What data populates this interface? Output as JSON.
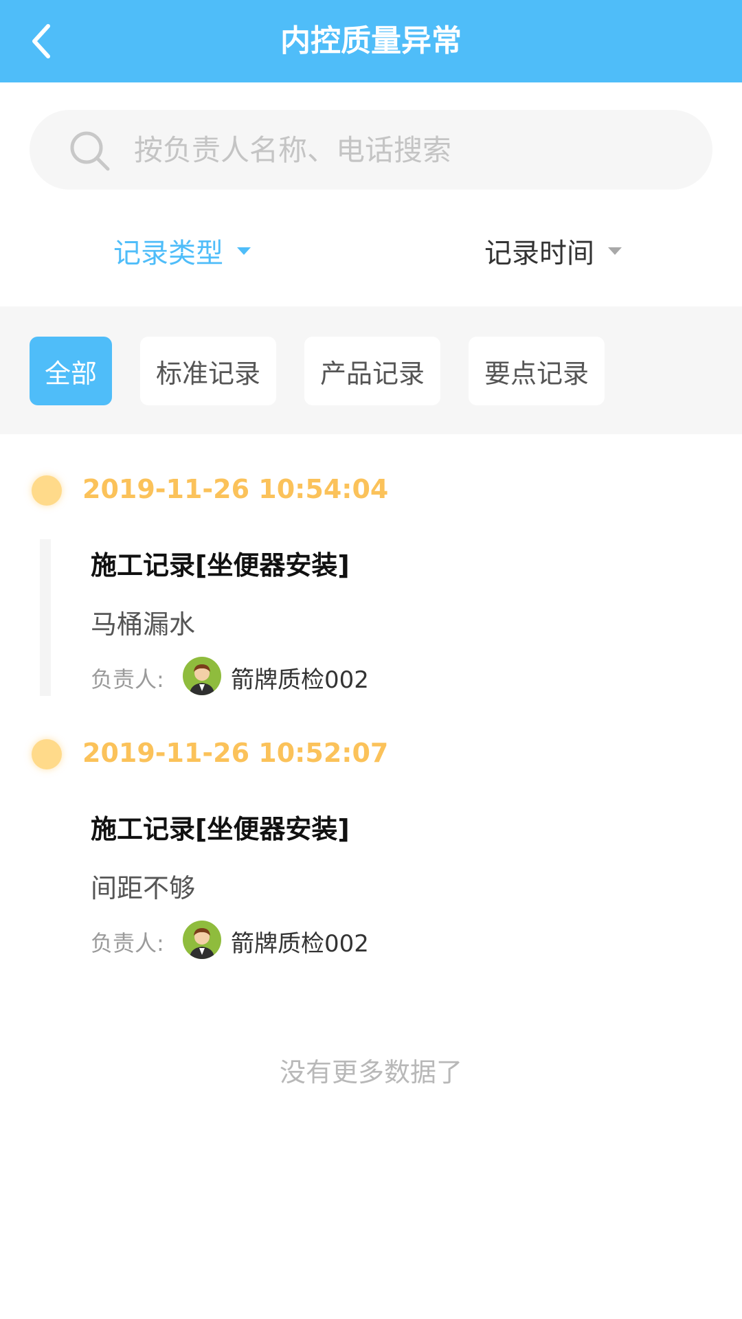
{
  "header": {
    "title": "内控质量异常",
    "back_icon": "chevron-left-icon"
  },
  "search": {
    "placeholder": "按负责人名称、电话搜索",
    "value": "",
    "icon": "search-icon"
  },
  "filters": [
    {
      "label": "记录类型",
      "active": true
    },
    {
      "label": "记录时间",
      "active": false
    }
  ],
  "categories": [
    {
      "label": "全部",
      "selected": true
    },
    {
      "label": "标准记录",
      "selected": false
    },
    {
      "label": "产品记录",
      "selected": false
    },
    {
      "label": "要点记录",
      "selected": false
    }
  ],
  "records": [
    {
      "time": "2019-11-26 10:54:04",
      "title": "施工记录[坐便器安装]",
      "description": "马桶漏水",
      "owner_label": "负责人:",
      "owner_name": "箭牌质检002"
    },
    {
      "time": "2019-11-26 10:52:07",
      "title": "施工记录[坐便器安装]",
      "description": "间距不够",
      "owner_label": "负责人:",
      "owner_name": "箭牌质检002"
    }
  ],
  "footer": {
    "no_more_text": "没有更多数据了"
  },
  "colors": {
    "header_bg": "#4fbdf9",
    "accent": "#4fbdf9",
    "timeline_dot": "#ffda8a",
    "time_text": "#fbc25a",
    "avatar_bg": "#8fbc3d"
  }
}
